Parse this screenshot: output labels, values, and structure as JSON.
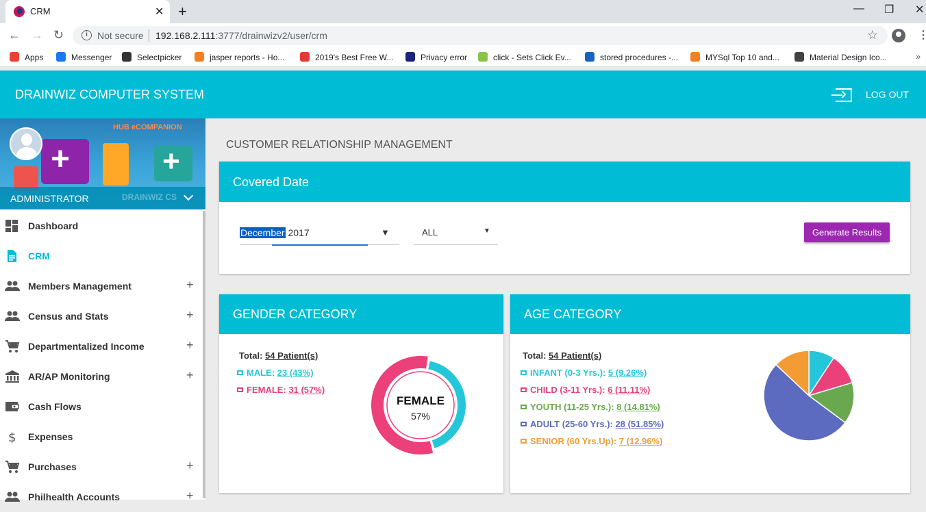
{
  "browser": {
    "tab_title": "CRM",
    "url_security": "Not secure",
    "url_host": "192.168.2.111",
    "url_path": ":3777/drainwizv2/user/crm",
    "bookmarks": [
      {
        "label": "Apps",
        "color": "#ea4335"
      },
      {
        "label": "Messenger",
        "color": "#1877f2"
      },
      {
        "label": "Selectpicker",
        "color": "#333333"
      },
      {
        "label": "jasper reports - Ho...",
        "color": "#f48024"
      },
      {
        "label": "2019's Best Free W...",
        "color": "#e53935"
      },
      {
        "label": "Privacy error",
        "color": "#1a237e"
      },
      {
        "label": "click - Sets Click Ev...",
        "color": "#8bc34a"
      },
      {
        "label": "stored procedures -...",
        "color": "#1565c0"
      },
      {
        "label": "MYSql Top 10 and...",
        "color": "#f48024"
      },
      {
        "label": "Material Design Ico...",
        "color": "#424242"
      }
    ]
  },
  "app": {
    "title": "DRAINWIZ COMPUTER SYSTEM",
    "logout": "LOG OUT",
    "banner_tag": "HUB eCOMPANION",
    "role": "ADMINISTRATOR",
    "watermark": "DRAINWIZ CS"
  },
  "sidebar": {
    "items": [
      {
        "label": "Dashboard",
        "icon": "dashboard-icon",
        "expandable": false,
        "active": false
      },
      {
        "label": "CRM",
        "icon": "document-icon",
        "expandable": false,
        "active": true
      },
      {
        "label": "Members Management",
        "icon": "people-icon",
        "expandable": true,
        "active": false
      },
      {
        "label": "Census and Stats",
        "icon": "people-icon",
        "expandable": true,
        "active": false
      },
      {
        "label": "Departmentalized Income",
        "icon": "cart-icon",
        "expandable": true,
        "active": false
      },
      {
        "label": "AR/AP Monitoring",
        "icon": "bank-icon",
        "expandable": true,
        "active": false
      },
      {
        "label": "Cash Flows",
        "icon": "wallet-icon",
        "expandable": false,
        "active": false
      },
      {
        "label": "Expenses",
        "icon": "dollar-icon",
        "expandable": false,
        "active": false
      },
      {
        "label": "Purchases",
        "icon": "cart-icon",
        "expandable": true,
        "active": false
      },
      {
        "label": "Philhealth Accounts",
        "icon": "people-icon",
        "expandable": true,
        "active": false
      }
    ],
    "plus_symbol": "+"
  },
  "page": {
    "breadcrumb": "CUSTOMER RELATIONSHIP MANAGEMENT",
    "covered_date": {
      "title": "Covered Date",
      "month_selected": "December",
      "year": "2017",
      "filter_value": "ALL",
      "generate_button": "Generate Results"
    },
    "gender": {
      "title": "GENDER CATEGORY",
      "total_label": "Total:",
      "total_value": "54 Patient(s)",
      "rows": [
        {
          "label": "MALE:",
          "value": "23 (43%)",
          "color": "#26c6da"
        },
        {
          "label": "FEMALE:",
          "value": "31 (57%)",
          "color": "#ec407a"
        }
      ],
      "center_label": "FEMALE",
      "center_value": "57%"
    },
    "age": {
      "title": "AGE CATEGORY",
      "total_label": "Total:",
      "total_value": "54 Patient(s)",
      "rows": [
        {
          "label": "INFANT (0-3 Yrs.):",
          "value": "5 (9.26%)",
          "color": "#26c6da"
        },
        {
          "label": "CHILD (3-11 Yrs.):",
          "value": "6 (11.11%)",
          "color": "#ec407a"
        },
        {
          "label": "YOUTH (11-25 Yrs.):",
          "value": "8 (14.81%)",
          "color": "#6aa84f"
        },
        {
          "label": "ADULT (25-60 Yrs.):",
          "value": "28 (51.85%)",
          "color": "#5c6bc0"
        },
        {
          "label": "SENIOR (60 Yrs.Up):",
          "value": "7 (12.96%)",
          "color": "#f39c34"
        }
      ]
    }
  },
  "chart_data": [
    {
      "type": "pie",
      "variant": "donut",
      "categories": [
        "MALE",
        "FEMALE"
      ],
      "values": [
        23,
        31
      ],
      "colors": [
        "#26c6da",
        "#ec407a"
      ]
    },
    {
      "type": "pie",
      "categories": [
        "INFANT",
        "CHILD",
        "YOUTH",
        "ADULT",
        "SENIOR"
      ],
      "values": [
        5,
        6,
        8,
        28,
        7
      ],
      "colors": [
        "#26c6da",
        "#ec407a",
        "#6aa84f",
        "#5c6bc0",
        "#f39c34"
      ]
    }
  ]
}
